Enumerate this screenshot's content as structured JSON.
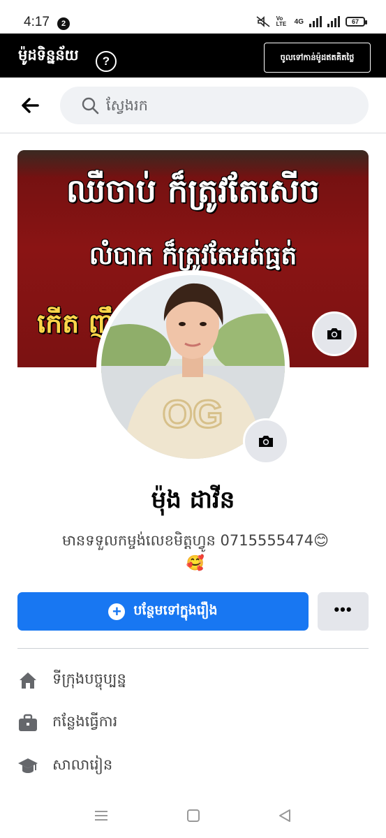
{
  "status_bar": {
    "time": "4:17",
    "notification_count": "2",
    "network_label": "4G",
    "volte_label": "Vo LTE",
    "battery": "67"
  },
  "promo_bar": {
    "title": "ម៉ូដទិន្នន័យ",
    "help": "?",
    "cta": "ចូលទៅកាន់ម៉ូដឥតគិតថ្លៃ"
  },
  "search": {
    "placeholder": "ស្វែងរក"
  },
  "cover": {
    "line1": "ឈឺចាប់  ក៏ត្រូវតែសើច",
    "line2": "លំបាក  ក៏ត្រូវតែអត់ធ្មត់",
    "line3": "កើត                 ញឹម"
  },
  "profile": {
    "name": "ម៉ុង ដាវីន",
    "bio_line1": "មានទទួលកម្ចង់លេខមិត្តហ្វូន 0715555474😊",
    "bio_line2": "🥰"
  },
  "actions": {
    "add_story": "បន្ថែមទៅក្នុងរឿង",
    "more": "•••"
  },
  "details": [
    {
      "icon": "home-icon",
      "label": "ទីក្រុងបច្ចុប្បន្ន"
    },
    {
      "icon": "briefcase-icon",
      "label": "កន្លែងធ្វើការ"
    },
    {
      "icon": "graduation-cap-icon",
      "label": "សាលារៀន"
    }
  ],
  "colors": {
    "accent": "#1877f2",
    "banner": "#000000",
    "cover_red": "#8a1414",
    "cover_yellow": "#ffd64a"
  }
}
